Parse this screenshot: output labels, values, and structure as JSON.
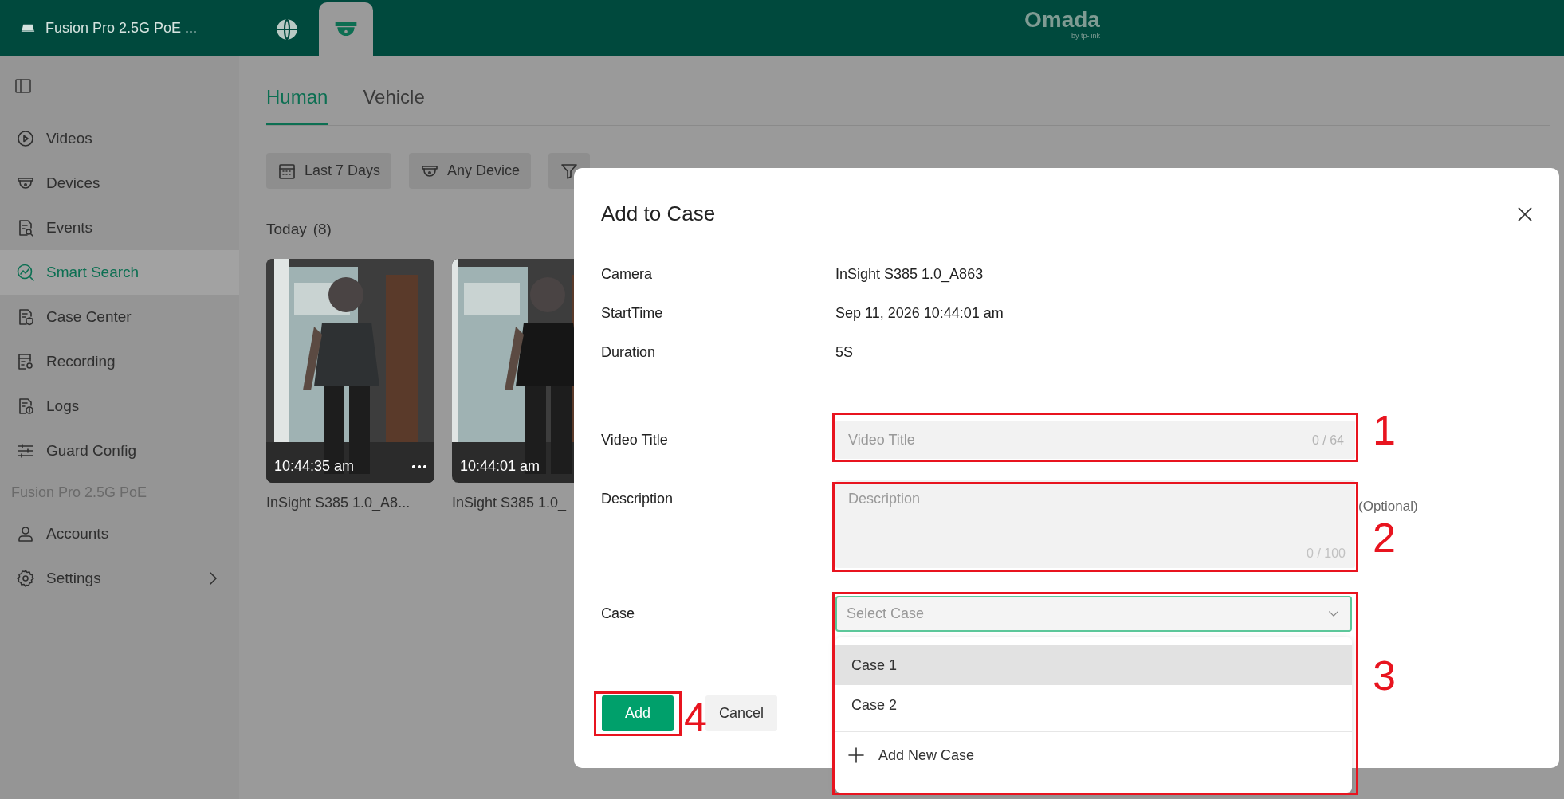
{
  "top_bar": {
    "device": "Fusion Pro 2.5G PoE ...",
    "apps": [
      {
        "selected": false
      },
      {
        "selected": true
      }
    ],
    "logo": "Omada",
    "logo_sub": "by tp-link"
  },
  "sidebar": {
    "items": [
      {
        "label": "Videos",
        "selected": false
      },
      {
        "label": "Devices",
        "selected": false
      },
      {
        "label": "Events",
        "selected": false
      },
      {
        "label": "Smart Search",
        "selected": true
      },
      {
        "label": "Case Center",
        "selected": false
      },
      {
        "label": "Recording",
        "selected": false
      },
      {
        "label": "Logs",
        "selected": false
      },
      {
        "label": "Guard Config",
        "selected": false
      }
    ],
    "section": "Fusion Pro 2.5G PoE",
    "section_items": [
      {
        "label": "Accounts",
        "selected": false,
        "expandable": false
      },
      {
        "label": "Settings",
        "selected": false,
        "expandable": true
      }
    ]
  },
  "tabs": [
    {
      "label": "Human",
      "selected": true
    },
    {
      "label": "Vehicle",
      "selected": false
    }
  ],
  "filters": [
    {
      "kind": "labeled",
      "label": "Last 7 Days"
    },
    {
      "kind": "labeled",
      "label": "Any Device"
    },
    {
      "kind": "icon-only"
    }
  ],
  "group": {
    "label": "Today",
    "count": "(8)"
  },
  "clips": [
    {
      "time": "10:44:35 am",
      "name": "InSight S385 1.0_A8...",
      "menu": true
    },
    {
      "time": "10:44:01 am",
      "name": "InSight S385 1.0_",
      "menu": false
    }
  ],
  "dialog": {
    "title": "Add to Case",
    "info": [
      {
        "label": "Camera",
        "value": "InSight S385 1.0_A863"
      },
      {
        "label": "StartTime",
        "value": "Sep 11, 2026 10:44:01 am"
      },
      {
        "label": "Duration",
        "value": "5S"
      }
    ],
    "video_title": {
      "label": "Video Title",
      "placeholder": "Video Title",
      "counter": "0 / 64"
    },
    "description": {
      "label": "Description",
      "placeholder": "Description",
      "counter": "0 / 100",
      "note": "(Optional)"
    },
    "case": {
      "label": "Case",
      "placeholder": "Select Case",
      "expanded": true,
      "options": [
        {
          "label": "Case 1",
          "highlighted": true
        },
        {
          "label": "Case 2",
          "highlighted": false
        }
      ],
      "add_new": "Add New Case"
    },
    "buttons": [
      {
        "kind": "primary",
        "label": "Add"
      },
      {
        "kind": "secondary",
        "label": "Cancel"
      }
    ]
  },
  "annotations": [
    {
      "label": "1"
    },
    {
      "label": "2"
    },
    {
      "label": "3"
    },
    {
      "label": "4"
    }
  ]
}
